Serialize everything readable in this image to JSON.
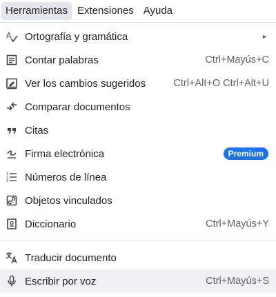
{
  "menubar": {
    "items": [
      {
        "label": "Herramientas"
      },
      {
        "label": "Extensiones"
      },
      {
        "label": "Ayuda"
      }
    ]
  },
  "menu": {
    "items": [
      {
        "label": "Ortografía y gramática",
        "shortcut": "",
        "icon": "spellcheck-icon",
        "submenu_arrow": "►"
      },
      {
        "label": "Contar palabras",
        "shortcut": "Ctrl+Mayús+C",
        "icon": "word-count-icon"
      },
      {
        "label": "Ver los cambios sugeridos",
        "shortcut": "Ctrl+Alt+O Ctrl+Alt+U",
        "icon": "review-edits-icon"
      },
      {
        "label": "Comparar documentos",
        "shortcut": "",
        "icon": "compare-icon"
      },
      {
        "label": "Citas",
        "shortcut": "",
        "icon": "quote-icon"
      },
      {
        "label": "Firma electrónica",
        "shortcut": "",
        "icon": "signature-icon",
        "badge": "Premium"
      },
      {
        "label": "Números de línea",
        "shortcut": "",
        "icon": "line-numbers-icon"
      },
      {
        "label": "Objetos vinculados",
        "shortcut": "",
        "icon": "linked-objects-icon"
      },
      {
        "label": "Diccionario",
        "shortcut": "Ctrl+Mayús+Y",
        "icon": "dictionary-icon"
      },
      {
        "label": "Traducir documento",
        "shortcut": "",
        "icon": "translate-icon"
      },
      {
        "label": "Escribir por voz",
        "shortcut": "Ctrl+Mayús+S",
        "icon": "microphone-icon"
      }
    ]
  },
  "colors": {
    "badge": "#1a73e8",
    "hover": "#eef0f3",
    "active_menubar": "#e3e7ed"
  }
}
